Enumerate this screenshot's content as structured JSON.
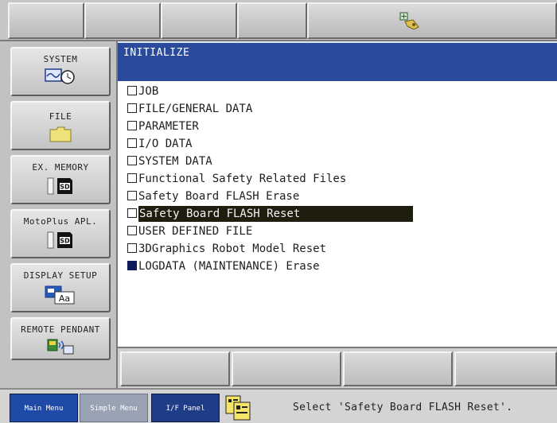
{
  "window": {
    "title": "INITIALIZE"
  },
  "left_menu": [
    {
      "label": "SYSTEM",
      "icon": "system-clock-icon"
    },
    {
      "label": "FILE",
      "icon": "folder-icon"
    },
    {
      "label": "EX. MEMORY",
      "icon": "sd-card-icon"
    },
    {
      "label": "MotoPlus APL.",
      "icon": "sd-card-icon"
    },
    {
      "label": "DISPLAY SETUP",
      "icon": "display-setup-icon"
    },
    {
      "label": "REMOTE PENDANT",
      "icon": "remote-pendant-icon"
    }
  ],
  "init_items": [
    {
      "label": "JOB",
      "checked": false
    },
    {
      "label": "FILE/GENERAL DATA",
      "checked": false
    },
    {
      "label": "PARAMETER",
      "checked": false
    },
    {
      "label": "I/O DATA",
      "checked": false
    },
    {
      "label": "SYSTEM DATA",
      "checked": false
    },
    {
      "label": "Functional Safety Related Files",
      "checked": false
    },
    {
      "label": "Safety Board FLASH Erase",
      "checked": false
    },
    {
      "label": "Safety Board FLASH Reset",
      "checked": false,
      "selected": true
    },
    {
      "label": "USER DEFINED FILE",
      "checked": false
    },
    {
      "label": "3DGraphics Robot Model Reset",
      "checked": false
    },
    {
      "label": "LOGDATA (MAINTENANCE) Erase",
      "checked": true
    }
  ],
  "status_bar": {
    "main_menu": "Main Menu",
    "simple_menu": "Simple Menu",
    "if_panel": "I/F Panel",
    "message": "Select 'Safety Board FLASH Reset'."
  },
  "colors": {
    "title_bar": "#2a4a9c",
    "selection": "#1f1d0e",
    "main_menu_tab": "#1f4aa8",
    "simple_menu_tab": "#9aa3b4",
    "if_panel_tab": "#1f3d86"
  }
}
